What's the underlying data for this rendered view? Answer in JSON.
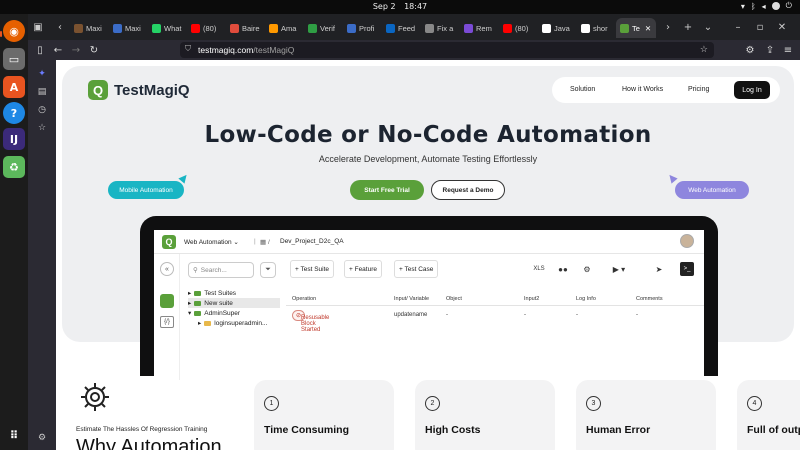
{
  "system": {
    "date": "Sep 2",
    "time": "18:47"
  },
  "tabs": [
    {
      "label": "Maxi",
      "color": "#7a5230"
    },
    {
      "label": "Maxi",
      "color": "#3b6cc7"
    },
    {
      "label": "What",
      "color": "#25d366"
    },
    {
      "label": "(80) ",
      "color": "#ff0000"
    },
    {
      "label": "Baire",
      "color": "#e04c3c"
    },
    {
      "label": "Ama",
      "color": "#ff9900"
    },
    {
      "label": "Verif",
      "color": "#2f9e44"
    },
    {
      "label": "Profi",
      "color": "#3b6cc7"
    },
    {
      "label": "Feed",
      "color": "#0a66c2"
    },
    {
      "label": "Fix a",
      "color": "#888888"
    },
    {
      "label": "Rem",
      "color": "#7b4bd6"
    },
    {
      "label": "(80) ",
      "color": "#ff0000"
    },
    {
      "label": "Java",
      "color": "#ffffff"
    },
    {
      "label": "shor",
      "color": "#ffffff"
    },
    {
      "label": "Te",
      "color": "#5aa03a"
    }
  ],
  "browser": {
    "url_host": "testmagiq.com",
    "url_path": "/testMagiQ"
  },
  "site": {
    "brand": "TestMagiQ",
    "brand_mark": "Q",
    "nav": [
      "Solution",
      "How it Works",
      "Pricing"
    ],
    "login": "Log In",
    "headline": "Low-Code or No-Code Automation",
    "subheadline": "Accelerate Development, Automate Testing Effortlessly",
    "chip_mobile": "Mobile Automation",
    "chip_web": "Web Automation",
    "cta_trial": "Start Free Trial",
    "cta_demo": "Request a Demo",
    "accent_green": "#5aa03a",
    "accent_teal": "#19b5c4",
    "accent_purple": "#8e86de"
  },
  "app": {
    "mode": "Web Automation",
    "project": "Dev_Project_D2c_QA",
    "search_placeholder": "Search...",
    "toolbar": [
      "+ Test Suite",
      "+ Feature",
      "+ Test Case"
    ],
    "tree": [
      {
        "label": "Test Suites",
        "caret": "▸",
        "selected": false
      },
      {
        "label": "New suite",
        "caret": "▸",
        "selected": true
      },
      {
        "label": "AdminSuper",
        "caret": "▾",
        "selected": false
      },
      {
        "label": "loginsuperadmin...",
        "caret": "▸",
        "selected": false
      }
    ],
    "columns": [
      "Operation",
      "Input/ Variable",
      "Object",
      "Input2",
      "Log Info",
      "Comments"
    ],
    "row": {
      "operation": "Resusable Block Started",
      "input": "updatename",
      "object": "-",
      "input2": "-",
      "log": "-",
      "comments": "-"
    }
  },
  "section": {
    "eyebrow": "Estimate The Hassles Of Regression Training",
    "title": "Why Automation",
    "cards": [
      {
        "num": "1",
        "title": "Time Consuming"
      },
      {
        "num": "2",
        "title": "High Costs"
      },
      {
        "num": "3",
        "title": "Human Error"
      },
      {
        "num": "4",
        "title": "Full of outp"
      }
    ]
  }
}
